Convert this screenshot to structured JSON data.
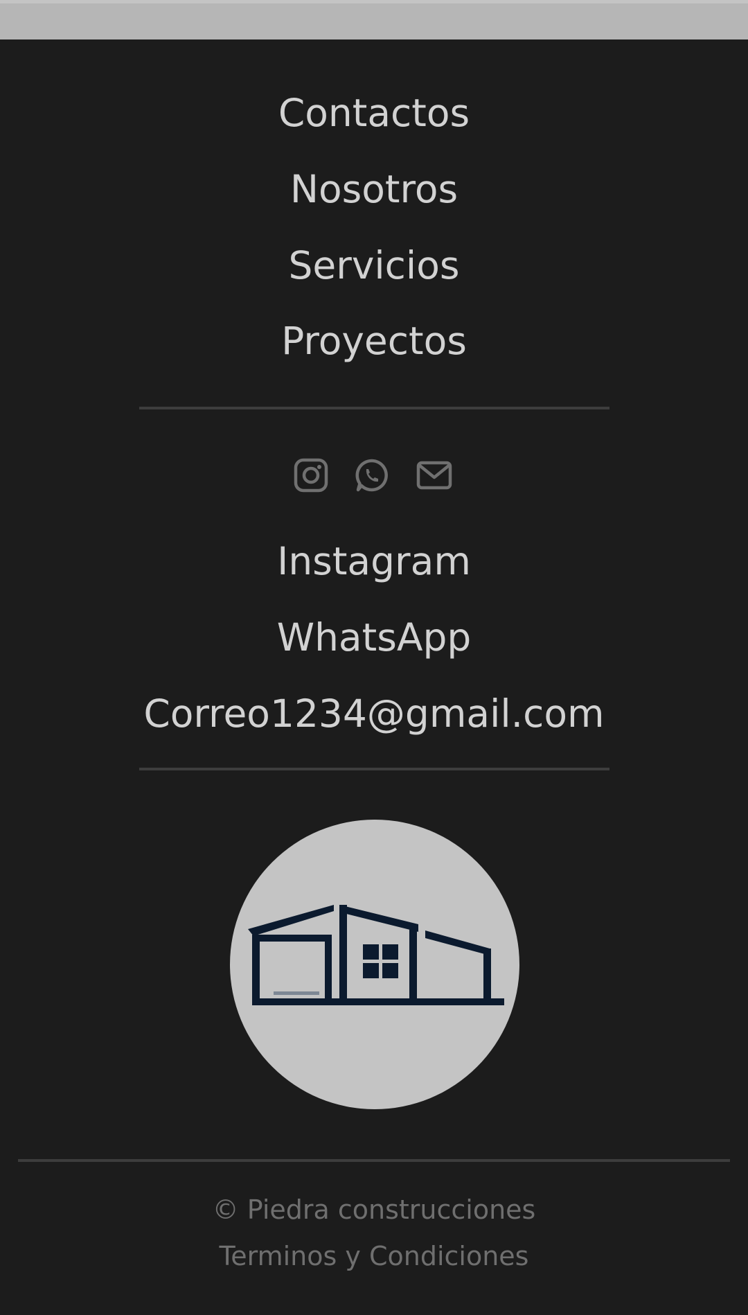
{
  "nav": {
    "items": [
      {
        "label": "Contactos"
      },
      {
        "label": "Nosotros"
      },
      {
        "label": "Servicios"
      },
      {
        "label": "Proyectos"
      }
    ]
  },
  "social": {
    "icons": [
      "instagram-icon",
      "whatsapp-icon",
      "envelope-icon"
    ],
    "links": [
      {
        "label": "Instagram"
      },
      {
        "label": "WhatsApp"
      },
      {
        "label": "Correo1234@gmail.com"
      }
    ]
  },
  "logo": {
    "icon": "house-logo",
    "background": "#c4c4c4",
    "ink": "#0b1a2e"
  },
  "legal": {
    "copyright": "© Piedra construcciones",
    "terms": "Terminos y Condiciones"
  },
  "colors": {
    "background": "#1c1c1c",
    "link_text": "#d2d2d2",
    "muted_text": "#6f6f6f",
    "divider": "#3d3d3d"
  }
}
